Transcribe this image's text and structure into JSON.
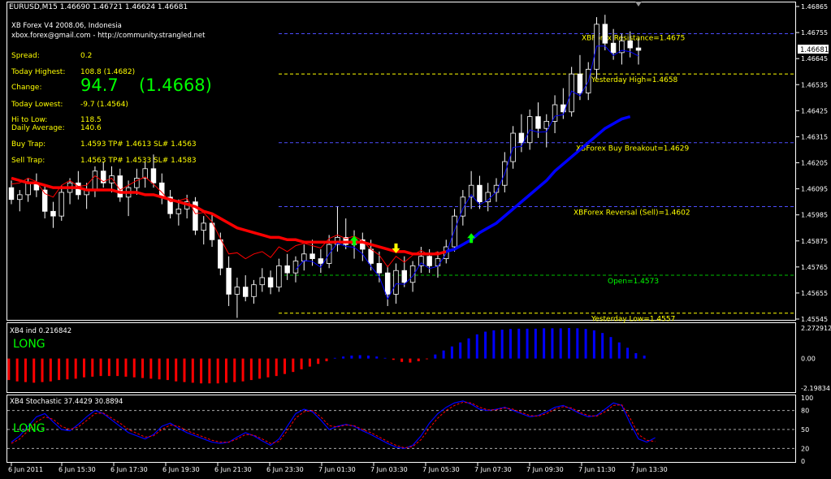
{
  "header": {
    "symbol_line": "EURUSD,M15  1.46690 1.46721 1.46624 1.46681",
    "indicator_name": "XB Forex V4 2008.06, Indonesia",
    "contact": "xbox.forex@gmail.com  -  http://community.strangled.net"
  },
  "info_panel": {
    "spread_label": "Spread:",
    "spread_value": "0.2",
    "today_highest_label": "Today Highest:",
    "today_highest_value": "108.8  (1.4682)",
    "change_label": "Change:",
    "change_pips": "94.7",
    "change_price": "(1.4668)",
    "today_lowest_label": "Today Lowest:",
    "today_lowest_value": "-9.7  (1.4564)",
    "hi_to_low_label": "Hi to Low:",
    "hi_to_low_value": "118.5",
    "daily_average_label": "Daily Average:",
    "daily_average_value": "140.6",
    "buy_trap_label": "Buy Trap:",
    "buy_trap_value": "1.4593  TP# 1.4613  SL# 1.4563",
    "sell_trap_label": "Sell Trap:",
    "sell_trap_value": "1.4563  TP# 1.4533  SL# 1.4583"
  },
  "levels": [
    {
      "label": "XBForex Resistance=1.4675",
      "price": 1.4675,
      "color": "#4d4dff",
      "label_color": "#ffff00"
    },
    {
      "label": "Yesterday High=1.4658",
      "price": 1.4658,
      "color": "#ffff00",
      "label_color": "#ffff00"
    },
    {
      "label": "XBForex Buy Breakout=1.4629",
      "price": 1.4629,
      "color": "#4d4dff",
      "label_color": "#ffff00"
    },
    {
      "label": "XBForex Reversal (Sell)=1.4602",
      "price": 1.4602,
      "color": "#4d4dff",
      "label_color": "#ffff00"
    },
    {
      "label": "Open=1.4573",
      "price": 1.4573,
      "color": "#00c000",
      "label_color": "#00ff00"
    },
    {
      "label": "Yesterday Low=1.4557",
      "price": 1.4557,
      "color": "#ffff00",
      "label_color": "#ffff00"
    }
  ],
  "current_price_tag": "1.46681",
  "colors": {
    "bull": "#ffffff",
    "bear": "#ffffff",
    "candle_fill": "#000000",
    "ma_fast": "#ff0000",
    "ma_slow_up": "#0000ff",
    "ind_pos": "#0000ff",
    "ind_neg": "#ff0000",
    "stoch_main": "#0000ff",
    "stoch_signal": "#ff0000",
    "long_text": "#00ff00",
    "axis": "#ffffff"
  },
  "indicator": {
    "title": "XB4 ind 0.216842",
    "signal": "LONG",
    "ticks": [
      "2.272912",
      "0.00",
      "-2.19834"
    ]
  },
  "stochastic": {
    "title": "XB4 Stochastic 37.4429 30.8894",
    "signal": "LONG",
    "ticks": [
      "100",
      "80",
      "50",
      "20",
      "0"
    ]
  },
  "chart_data": {
    "type": "candlestick",
    "symbol": "EURUSD",
    "timeframe": "M15",
    "ylim": [
      1.45545,
      1.46865
    ],
    "y_ticks": [
      "1.46865",
      "1.46755",
      "1.46645",
      "1.46535",
      "1.46425",
      "1.46315",
      "1.46205",
      "1.46095",
      "1.45985",
      "1.45875",
      "1.45765",
      "1.45655",
      "1.45545"
    ],
    "x_ticks": [
      "6 Jun 2011",
      "6 Jun 15:30",
      "6 Jun 17:30",
      "6 Jun 19:30",
      "6 Jun 21:30",
      "6 Jun 23:30",
      "7 Jun 01:30",
      "7 Jun 03:30",
      "7 Jun 05:30",
      "7 Jun 07:30",
      "7 Jun 09:30",
      "7 Jun 11:30",
      "7 Jun 13:30"
    ],
    "ohlc": [
      [
        1.461,
        1.4613,
        1.4603,
        1.4605
      ],
      [
        1.4605,
        1.4609,
        1.46,
        1.4607
      ],
      [
        1.4607,
        1.4614,
        1.4604,
        1.4612
      ],
      [
        1.4612,
        1.4616,
        1.4606,
        1.4609
      ],
      [
        1.4609,
        1.4611,
        1.4597,
        1.46
      ],
      [
        1.46,
        1.4604,
        1.4593,
        1.4598
      ],
      [
        1.4598,
        1.4611,
        1.4596,
        1.4608
      ],
      [
        1.4608,
        1.4614,
        1.4603,
        1.4612
      ],
      [
        1.4612,
        1.4617,
        1.4605,
        1.4607
      ],
      [
        1.4607,
        1.4612,
        1.4601,
        1.4609
      ],
      [
        1.4609,
        1.4619,
        1.4606,
        1.4617
      ],
      [
        1.4617,
        1.4621,
        1.461,
        1.4612
      ],
      [
        1.4612,
        1.4619,
        1.4608,
        1.4615
      ],
      [
        1.4615,
        1.4618,
        1.4604,
        1.4606
      ],
      [
        1.4606,
        1.4613,
        1.4598,
        1.461
      ],
      [
        1.461,
        1.4618,
        1.4607,
        1.4614
      ],
      [
        1.4614,
        1.4621,
        1.461,
        1.4618
      ],
      [
        1.4618,
        1.4624,
        1.461,
        1.4612
      ],
      [
        1.4612,
        1.4616,
        1.4603,
        1.4606
      ],
      [
        1.4606,
        1.4609,
        1.4597,
        1.4599
      ],
      [
        1.4599,
        1.4605,
        1.4594,
        1.4601
      ],
      [
        1.4601,
        1.4607,
        1.4597,
        1.4604
      ],
      [
        1.4604,
        1.4606,
        1.459,
        1.4592
      ],
      [
        1.4592,
        1.4598,
        1.4586,
        1.4595
      ],
      [
        1.4595,
        1.4599,
        1.4585,
        1.4588
      ],
      [
        1.4588,
        1.4591,
        1.4573,
        1.4576
      ],
      [
        1.4576,
        1.4581,
        1.456,
        1.4565
      ],
      [
        1.4565,
        1.4572,
        1.4555,
        1.4568
      ],
      [
        1.4568,
        1.4573,
        1.4562,
        1.4564
      ],
      [
        1.4564,
        1.4571,
        1.4561,
        1.4569
      ],
      [
        1.4569,
        1.4576,
        1.4566,
        1.4572
      ],
      [
        1.4572,
        1.4575,
        1.4565,
        1.4568
      ],
      [
        1.4568,
        1.458,
        1.4566,
        1.4577
      ],
      [
        1.4577,
        1.4582,
        1.4571,
        1.4574
      ],
      [
        1.4574,
        1.4581,
        1.457,
        1.4579
      ],
      [
        1.4579,
        1.4586,
        1.4575,
        1.4582
      ],
      [
        1.4582,
        1.4588,
        1.4577,
        1.458
      ],
      [
        1.458,
        1.4584,
        1.4574,
        1.4578
      ],
      [
        1.4578,
        1.459,
        1.4576,
        1.4586
      ],
      [
        1.4586,
        1.4602,
        1.4583,
        1.4589
      ],
      [
        1.4589,
        1.4597,
        1.4584,
        1.4586
      ],
      [
        1.4586,
        1.4592,
        1.458,
        1.4588
      ],
      [
        1.4588,
        1.4591,
        1.4579,
        1.4584
      ],
      [
        1.4584,
        1.4588,
        1.4575,
        1.4578
      ],
      [
        1.4578,
        1.4583,
        1.457,
        1.4574
      ],
      [
        1.4574,
        1.4577,
        1.456,
        1.4565
      ],
      [
        1.4565,
        1.4578,
        1.4561,
        1.4575
      ],
      [
        1.4575,
        1.4581,
        1.4568,
        1.457
      ],
      [
        1.457,
        1.4579,
        1.4566,
        1.4577
      ],
      [
        1.4577,
        1.4585,
        1.4574,
        1.4581
      ],
      [
        1.4581,
        1.4584,
        1.4574,
        1.4577
      ],
      [
        1.4577,
        1.4583,
        1.4572,
        1.458
      ],
      [
        1.458,
        1.4588,
        1.4578,
        1.4585
      ],
      [
        1.4585,
        1.4601,
        1.4583,
        1.4598
      ],
      [
        1.4598,
        1.4609,
        1.4594,
        1.4606
      ],
      [
        1.4606,
        1.4617,
        1.4601,
        1.4611
      ],
      [
        1.4611,
        1.4615,
        1.4601,
        1.4604
      ],
      [
        1.4604,
        1.4612,
        1.46,
        1.4608
      ],
      [
        1.4608,
        1.4614,
        1.4604,
        1.4611
      ],
      [
        1.4611,
        1.4625,
        1.4608,
        1.4621
      ],
      [
        1.4621,
        1.4636,
        1.4618,
        1.4633
      ],
      [
        1.4633,
        1.4641,
        1.4625,
        1.4629
      ],
      [
        1.4629,
        1.4643,
        1.4626,
        1.464
      ],
      [
        1.464,
        1.4646,
        1.4631,
        1.4635
      ],
      [
        1.4635,
        1.4641,
        1.4627,
        1.4638
      ],
      [
        1.4638,
        1.4649,
        1.4633,
        1.4645
      ],
      [
        1.4645,
        1.4652,
        1.4639,
        1.4642
      ],
      [
        1.4642,
        1.4661,
        1.464,
        1.4658
      ],
      [
        1.4658,
        1.4666,
        1.4647,
        1.465
      ],
      [
        1.465,
        1.4663,
        1.4647,
        1.466
      ],
      [
        1.466,
        1.4682,
        1.4656,
        1.4679
      ],
      [
        1.4679,
        1.4683,
        1.4668,
        1.4671
      ],
      [
        1.4671,
        1.4677,
        1.4664,
        1.4667
      ],
      [
        1.4667,
        1.4675,
        1.4662,
        1.4672
      ],
      [
        1.4672,
        1.4676,
        1.4665,
        1.4669
      ],
      [
        1.4669,
        1.4673,
        1.4662,
        1.4668
      ]
    ],
    "ma_fast": [
      1.4614,
      1.4613,
      1.4612,
      1.4612,
      1.4611,
      1.461,
      1.461,
      1.461,
      1.461,
      1.4609,
      1.4609,
      1.4609,
      1.4609,
      1.4608,
      1.4608,
      1.4608,
      1.4607,
      1.4607,
      1.4606,
      1.4605,
      1.4604,
      1.4603,
      1.4602,
      1.46,
      1.4599,
      1.4597,
      1.4595,
      1.4593,
      1.4592,
      1.4591,
      1.459,
      1.4589,
      1.4589,
      1.4588,
      1.4588,
      1.4587,
      1.4587,
      1.4587,
      1.4587,
      1.4587,
      1.4587,
      1.4587,
      1.4587,
      1.4586,
      1.4585,
      1.4584,
      1.4583,
      1.4583,
      1.4582,
      1.4582,
      1.4582,
      1.4582,
      1.4583,
      1.4584,
      1.4586,
      1.4588,
      1.4591,
      1.4593,
      1.4595,
      1.4598,
      1.4601,
      1.4604,
      1.4607,
      1.461,
      1.4613,
      1.4617,
      1.462,
      1.4623,
      1.4626,
      1.4629,
      1.4632,
      1.4635,
      1.4637,
      1.4639,
      1.464
    ],
    "ma_fast_colors_blue_from_index": 52,
    "indicator_values": [
      -1.6,
      -1.7,
      -1.75,
      -1.8,
      -1.75,
      -1.7,
      -1.6,
      -1.55,
      -1.5,
      -1.4,
      -1.35,
      -1.3,
      -1.3,
      -1.3,
      -1.35,
      -1.4,
      -1.45,
      -1.5,
      -1.55,
      -1.6,
      -1.7,
      -1.75,
      -1.8,
      -1.85,
      -1.85,
      -1.85,
      -1.8,
      -1.75,
      -1.7,
      -1.6,
      -1.5,
      -1.4,
      -1.3,
      -1.15,
      -1.0,
      -0.8,
      -0.6,
      -0.4,
      -0.2,
      0.05,
      0.15,
      0.22,
      0.25,
      0.22,
      0.15,
      0.05,
      -0.1,
      -0.25,
      -0.3,
      -0.2,
      -0.05,
      0.3,
      0.6,
      0.9,
      1.2,
      1.5,
      1.8,
      2.0,
      2.1,
      2.15,
      2.2,
      2.22,
      2.22,
      2.22,
      2.25,
      2.25,
      2.25,
      2.27,
      2.25,
      2.2,
      2.1,
      1.9,
      1.6,
      1.2,
      0.8,
      0.4,
      0.22
    ],
    "stoch_main": [
      30,
      40,
      55,
      70,
      75,
      62,
      50,
      48,
      58,
      70,
      80,
      75,
      65,
      55,
      45,
      40,
      35,
      42,
      55,
      60,
      52,
      45,
      40,
      35,
      30,
      28,
      30,
      38,
      45,
      40,
      32,
      25,
      35,
      55,
      75,
      82,
      78,
      65,
      50,
      55,
      58,
      55,
      48,
      42,
      35,
      28,
      22,
      20,
      25,
      40,
      60,
      75,
      85,
      92,
      95,
      90,
      82,
      80,
      82,
      85,
      80,
      75,
      70,
      72,
      78,
      85,
      88,
      82,
      75,
      70,
      72,
      82,
      92,
      88,
      60,
      35,
      30,
      37
    ],
    "stoch_signal": [
      28,
      35,
      48,
      62,
      70,
      66,
      55,
      50,
      54,
      64,
      75,
      76,
      68,
      60,
      50,
      44,
      38,
      40,
      50,
      57,
      55,
      48,
      43,
      38,
      33,
      30,
      30,
      35,
      42,
      41,
      35,
      28,
      31,
      48,
      68,
      78,
      80,
      70,
      56,
      54,
      57,
      56,
      50,
      45,
      38,
      31,
      25,
      21,
      23,
      34,
      52,
      68,
      80,
      88,
      93,
      92,
      85,
      81,
      81,
      84,
      82,
      77,
      72,
      71,
      75,
      82,
      86,
      84,
      77,
      72,
      71,
      78,
      88,
      89,
      68,
      42,
      33,
      31
    ]
  }
}
